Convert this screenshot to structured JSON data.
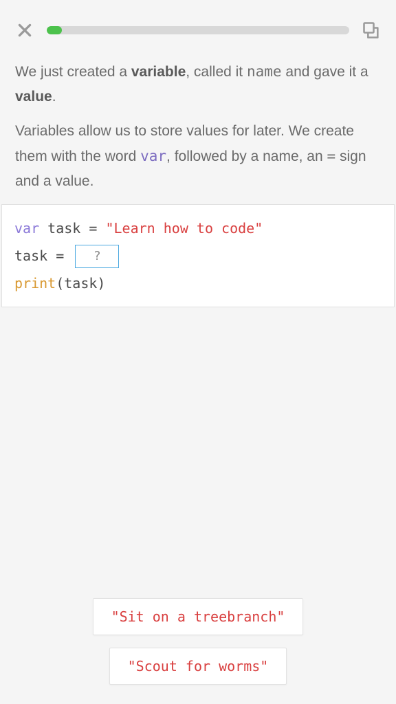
{
  "header": {
    "progress_percent": 5
  },
  "lesson": {
    "p1_pre": "We just created a ",
    "p1_var": "variable",
    "p1_mid": ", called it ",
    "p1_name": "name",
    "p1_mid2": " and gave it a ",
    "p1_value": "value",
    "p1_end": ".",
    "p2_pre": "Variables allow us to store values for later. We create them with the word ",
    "p2_var": "var",
    "p2_mid": ", followed by a name, an ",
    "p2_eq": "=",
    "p2_end": " sign and a value."
  },
  "code": {
    "line1_kw": "var",
    "line1_name": " task ",
    "line1_eq": "= ",
    "line1_str": "\"Learn how to code\"",
    "line2_pre": "task ",
    "line2_eq": "= ",
    "blank_placeholder": "?",
    "line3_fn": "print",
    "line3_args": "(task)"
  },
  "options": {
    "opt1": "\"Sit on a treebranch\"",
    "opt2": "\"Scout for worms\""
  }
}
